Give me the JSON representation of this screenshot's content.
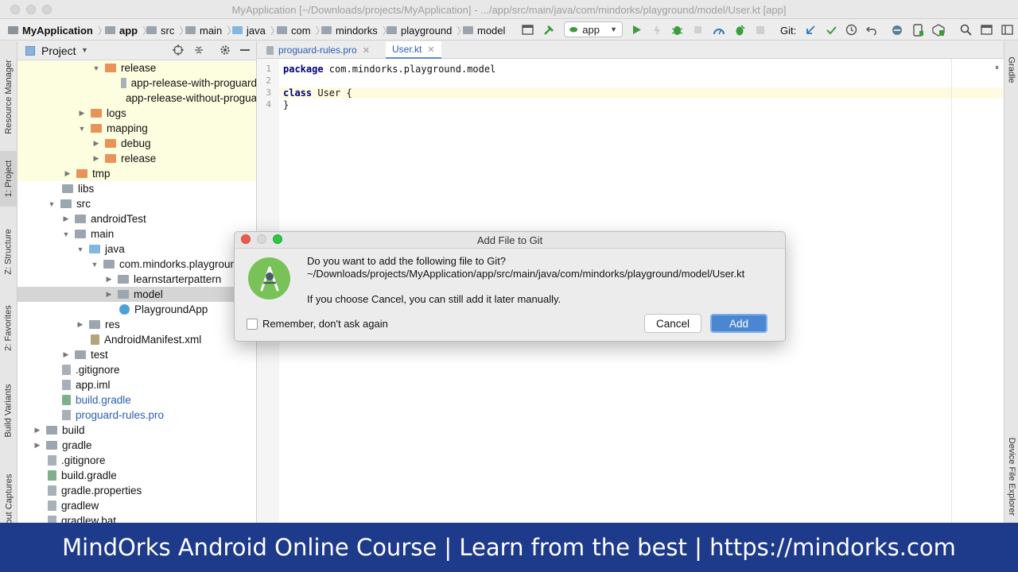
{
  "window": {
    "title": "MyApplication [~/Downloads/projects/MyApplication] - .../app/src/main/java/com/mindorks/playground/model/User.kt [app]"
  },
  "breadcrumb": [
    "MyApplication",
    "app",
    "src",
    "main",
    "java",
    "com",
    "mindorks",
    "playground",
    "model"
  ],
  "toolbar": {
    "run_config": "app",
    "git_label": "Git:"
  },
  "left_tool_tabs": [
    "Resource Manager",
    "1: Project",
    "Z: Structure",
    "2: Favorites",
    "Build Variants",
    "Layout Captures"
  ],
  "right_tool_tabs": [
    "Gradle",
    "Device File Explorer"
  ],
  "project_panel": {
    "title": "Project",
    "tree": [
      {
        "label": "release",
        "icon": "folder-orange",
        "expanded": true
      },
      {
        "label": "app-release-with-proguard",
        "icon": "file"
      },
      {
        "label": "app-release-without-proguard",
        "icon": "file"
      },
      {
        "label": "logs",
        "icon": "folder-orange",
        "expanded": false
      },
      {
        "label": "mapping",
        "icon": "folder-orange",
        "expanded": true
      },
      {
        "label": "debug",
        "icon": "folder-orange",
        "expanded": false
      },
      {
        "label": "release",
        "icon": "folder-orange",
        "expanded": false
      },
      {
        "label": "tmp",
        "icon": "folder-orange",
        "expanded": false
      },
      {
        "label": "libs",
        "icon": "folder"
      },
      {
        "label": "src",
        "icon": "folder",
        "expanded": true
      },
      {
        "label": "androidTest",
        "icon": "folder",
        "expanded": false
      },
      {
        "label": "main",
        "icon": "folder",
        "expanded": true
      },
      {
        "label": "java",
        "icon": "folder-blue",
        "expanded": true
      },
      {
        "label": "com.mindorks.playground",
        "icon": "folder",
        "expanded": true
      },
      {
        "label": "learnstarterpattern",
        "icon": "folder",
        "expanded": false
      },
      {
        "label": "model",
        "icon": "folder",
        "expanded": false
      },
      {
        "label": "PlaygroundApp",
        "icon": "kotlin-class"
      },
      {
        "label": "res",
        "icon": "folder",
        "expanded": false
      },
      {
        "label": "AndroidManifest.xml",
        "icon": "manifest"
      },
      {
        "label": "test",
        "icon": "folder",
        "expanded": false
      },
      {
        "label": ".gitignore",
        "icon": "file"
      },
      {
        "label": "app.iml",
        "icon": "file"
      },
      {
        "label": "build.gradle",
        "icon": "gradle"
      },
      {
        "label": "proguard-rules.pro",
        "icon": "file"
      },
      {
        "label": "build",
        "icon": "folder",
        "expanded": false
      },
      {
        "label": "gradle",
        "icon": "folder",
        "expanded": false
      },
      {
        "label": ".gitignore",
        "icon": "file"
      },
      {
        "label": "build.gradle",
        "icon": "gradle"
      },
      {
        "label": "gradle.properties",
        "icon": "file"
      },
      {
        "label": "gradlew",
        "icon": "file"
      },
      {
        "label": "gradlew.bat",
        "icon": "file"
      }
    ]
  },
  "editor": {
    "tabs": [
      {
        "label": "proguard-rules.pro",
        "active": false
      },
      {
        "label": "User.kt",
        "active": true
      }
    ],
    "lines": [
      {
        "num": "1",
        "keyword": "package",
        "rest": " com.mindorks.playground.model"
      },
      {
        "num": "2",
        "keyword": "",
        "rest": ""
      },
      {
        "num": "3",
        "keyword": "class",
        "rest": " User {"
      },
      {
        "num": "4",
        "keyword": "",
        "rest": "}"
      }
    ]
  },
  "dialog": {
    "title": "Add File to Git",
    "message": "Do you want to add the following file to Git?",
    "path": "~/Downloads/projects/MyApplication/app/src/main/java/com/mindorks/playground/model/User.kt",
    "note": "If you choose Cancel, you can still add it later manually.",
    "remember_label": "Remember, don't ask again",
    "remember_checked": false,
    "cancel_label": "Cancel",
    "add_label": "Add"
  },
  "banner": {
    "text": "MindOrks Android Online Course | Learn from the best | https://mindorks.com"
  },
  "colors": {
    "banner_bg": "#1e3a8a",
    "primary_button": "#4b87d1",
    "highlight_rows": "#fdfde0"
  }
}
